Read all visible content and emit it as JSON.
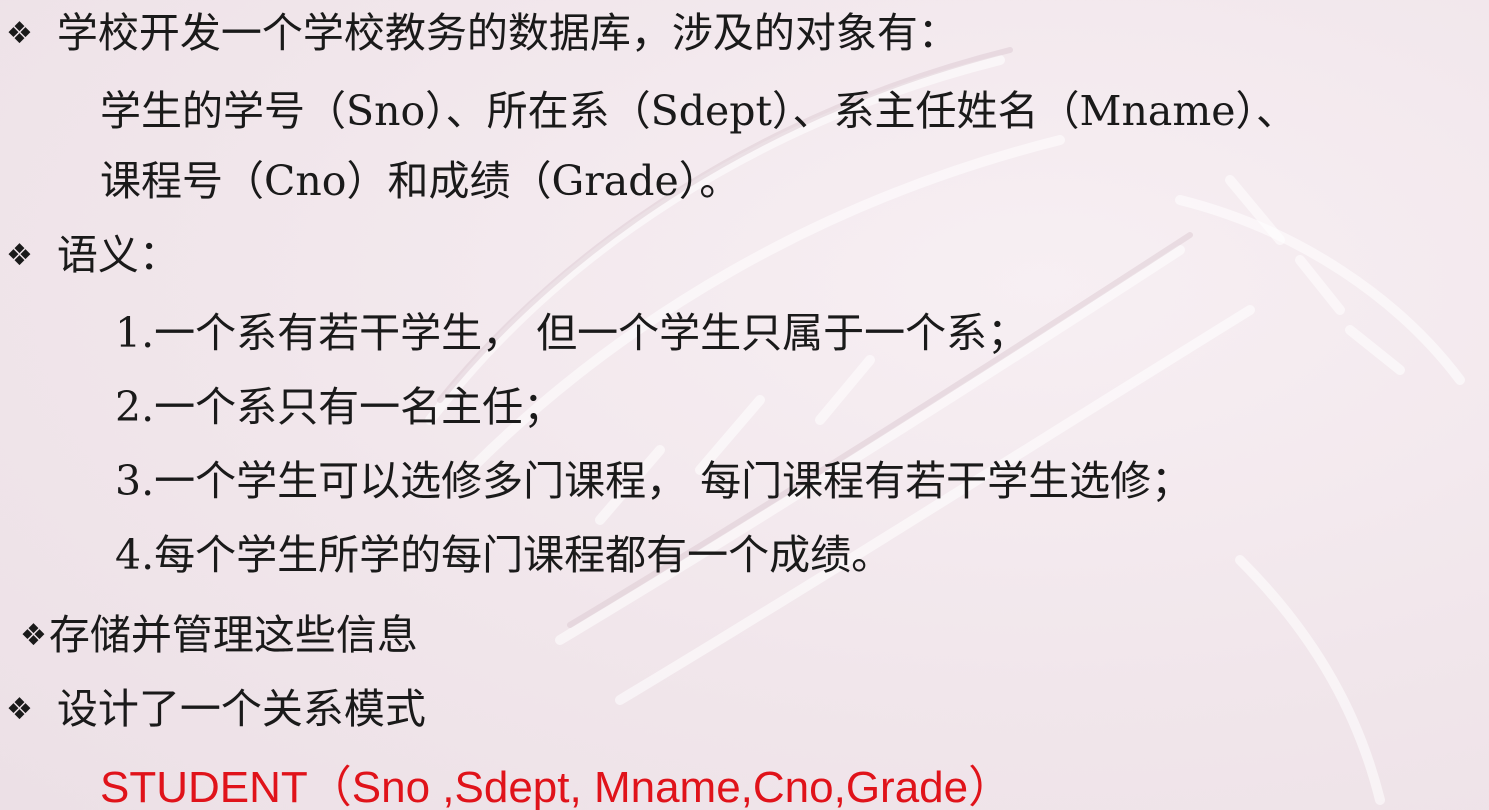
{
  "slide": {
    "bullet_symbol": "❖",
    "objects_heading": "学校开发一个学校教务的数据库，涉及的对象有：",
    "objects_line_1": "学生的学号（Sno）、所在系（Sdept）、系主任姓名（Mname）、",
    "objects_line_2": "课程号（Cno）和成绩（Grade）。",
    "semantics_heading": "语义：",
    "semantics_items": [
      "1.一个系有若干学生， 但一个学生只属于一个系；",
      "2.一个系只有一名主任；",
      "3.一个学生可以选修多门课程， 每门课程有若干学生选修；",
      "4.每个学生所学的每门课程都有一个成绩。"
    ],
    "store_heading": "存储并管理这些信息",
    "design_heading": "设计了一个关系模式",
    "schema": "STUDENT（Sno ,Sdept, Mname,Cno,Grade）"
  },
  "colors": {
    "background": "#f3e9ee",
    "text": "#1a1a1a",
    "schema": "#e0131a"
  }
}
